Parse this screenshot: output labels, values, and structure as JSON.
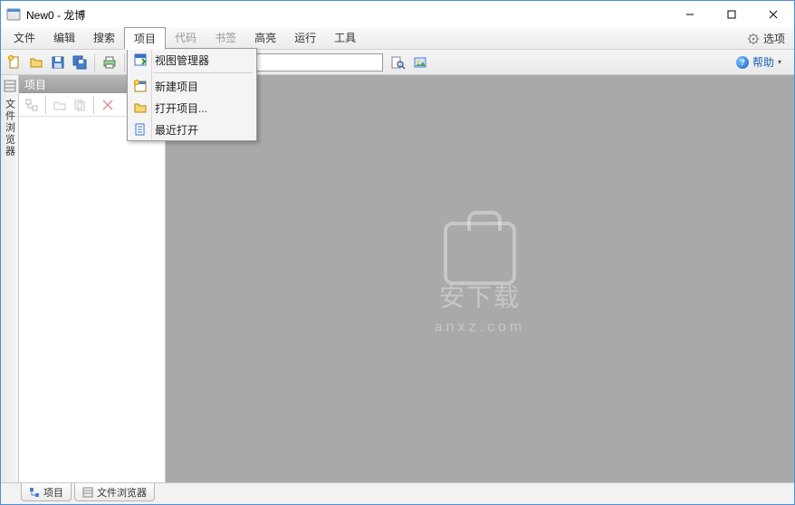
{
  "window": {
    "title": "New0 - 龙博"
  },
  "menubar": {
    "items": [
      "文件",
      "编辑",
      "搜索",
      "项目",
      "代码",
      "书签",
      "高亮",
      "运行",
      "工具"
    ],
    "active_index": 3,
    "dim_indices": [
      4,
      5
    ],
    "options_label": "选项"
  },
  "toolbar": {
    "search_placeholder": "",
    "help_label": "帮助"
  },
  "dropdown": {
    "items": [
      {
        "label": "视图管理器",
        "icon": "views-manager-icon"
      },
      {
        "sep": true
      },
      {
        "label": "新建项目",
        "icon": "new-project-icon"
      },
      {
        "label": "打开项目...",
        "icon": "open-folder-icon"
      },
      {
        "label": "最近打开",
        "icon": "recent-icon"
      }
    ]
  },
  "dock": {
    "label": "文件浏览器"
  },
  "side_panel": {
    "title": "项目"
  },
  "bottom_tabs": {
    "tab1": "项目",
    "tab2": "文件浏览器"
  },
  "watermark": {
    "main": "安下载",
    "sub": "anxz.com"
  }
}
